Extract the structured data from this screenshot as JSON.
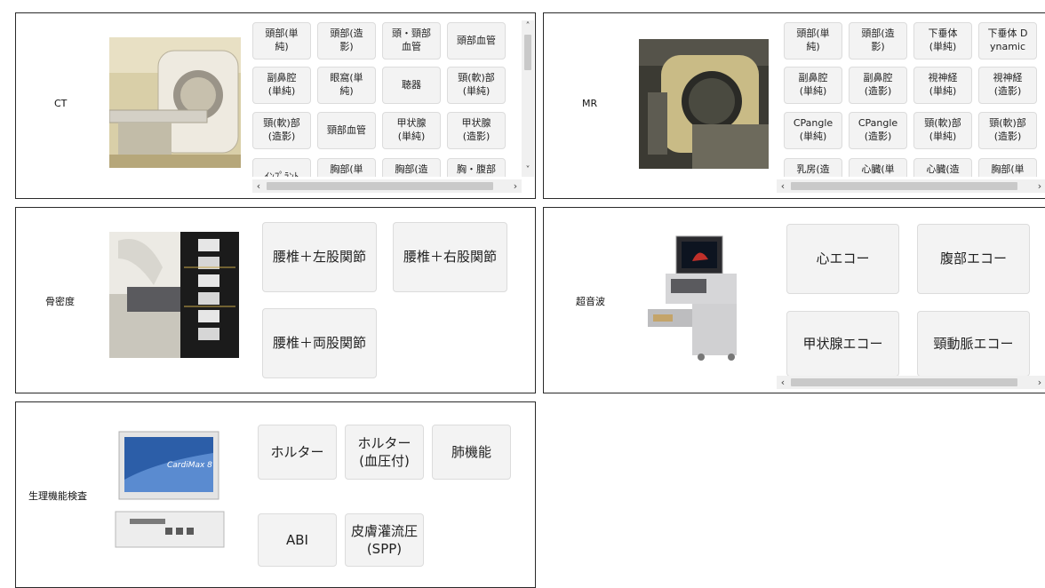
{
  "panels": {
    "ct": {
      "label": "CT",
      "buttons": [
        "頭部(単\n純)",
        "頭部(造\n影)",
        "頭・頸部\n血管",
        "頭部血管",
        "副鼻腔\n(単純)",
        "眼窩(単\n純)",
        "聴器",
        "頸(軟)部\n(単純)",
        "頸(軟)部\n(造影)",
        "頸部血管",
        "甲状腺\n(単純)",
        "甲状腺\n(造影)",
        "ｲﾝﾌﾟﾗﾝﾄ",
        "胸部(単\n純)",
        "胸部(造\n影)",
        "胸・腹部\n(単純)"
      ]
    },
    "mr": {
      "label": "MR",
      "buttons": [
        "頭部(単\n純)",
        "頭部(造\n影)",
        "下垂体\n(単純)",
        "下垂体 D\nynamic",
        "副鼻腔\n(単純)",
        "副鼻腔\n(造影)",
        "視神経\n(単純)",
        "視神経\n(造影)",
        "CPangle\n(単純)",
        "CPangle\n(造影)",
        "頸(軟)部\n(単純)",
        "頸(軟)部\n(造影)",
        "乳房(造\n影)",
        "心臓(単\n純)",
        "心臓(造\n影)",
        "胸部(単\n純)"
      ]
    },
    "bone": {
      "label": "骨密度",
      "buttons": [
        "腰椎＋左股関節",
        "腰椎＋右股関節",
        "腰椎＋両股関節"
      ]
    },
    "us": {
      "label": "超音波",
      "buttons": [
        "心エコー",
        "腹部エコー",
        "甲状腺エコー",
        "頸動脈エコー"
      ]
    },
    "physio": {
      "label": "生理機能検査",
      "buttons": [
        "ホルター",
        "ホルター\n(血圧付)",
        "肺機能",
        "ABI",
        "皮膚灌流圧\n(SPP)"
      ],
      "device_brand": "CardiMax 8"
    }
  },
  "scroll_icons": {
    "left": "‹",
    "right": "›",
    "up": "˄",
    "down": "˅"
  }
}
